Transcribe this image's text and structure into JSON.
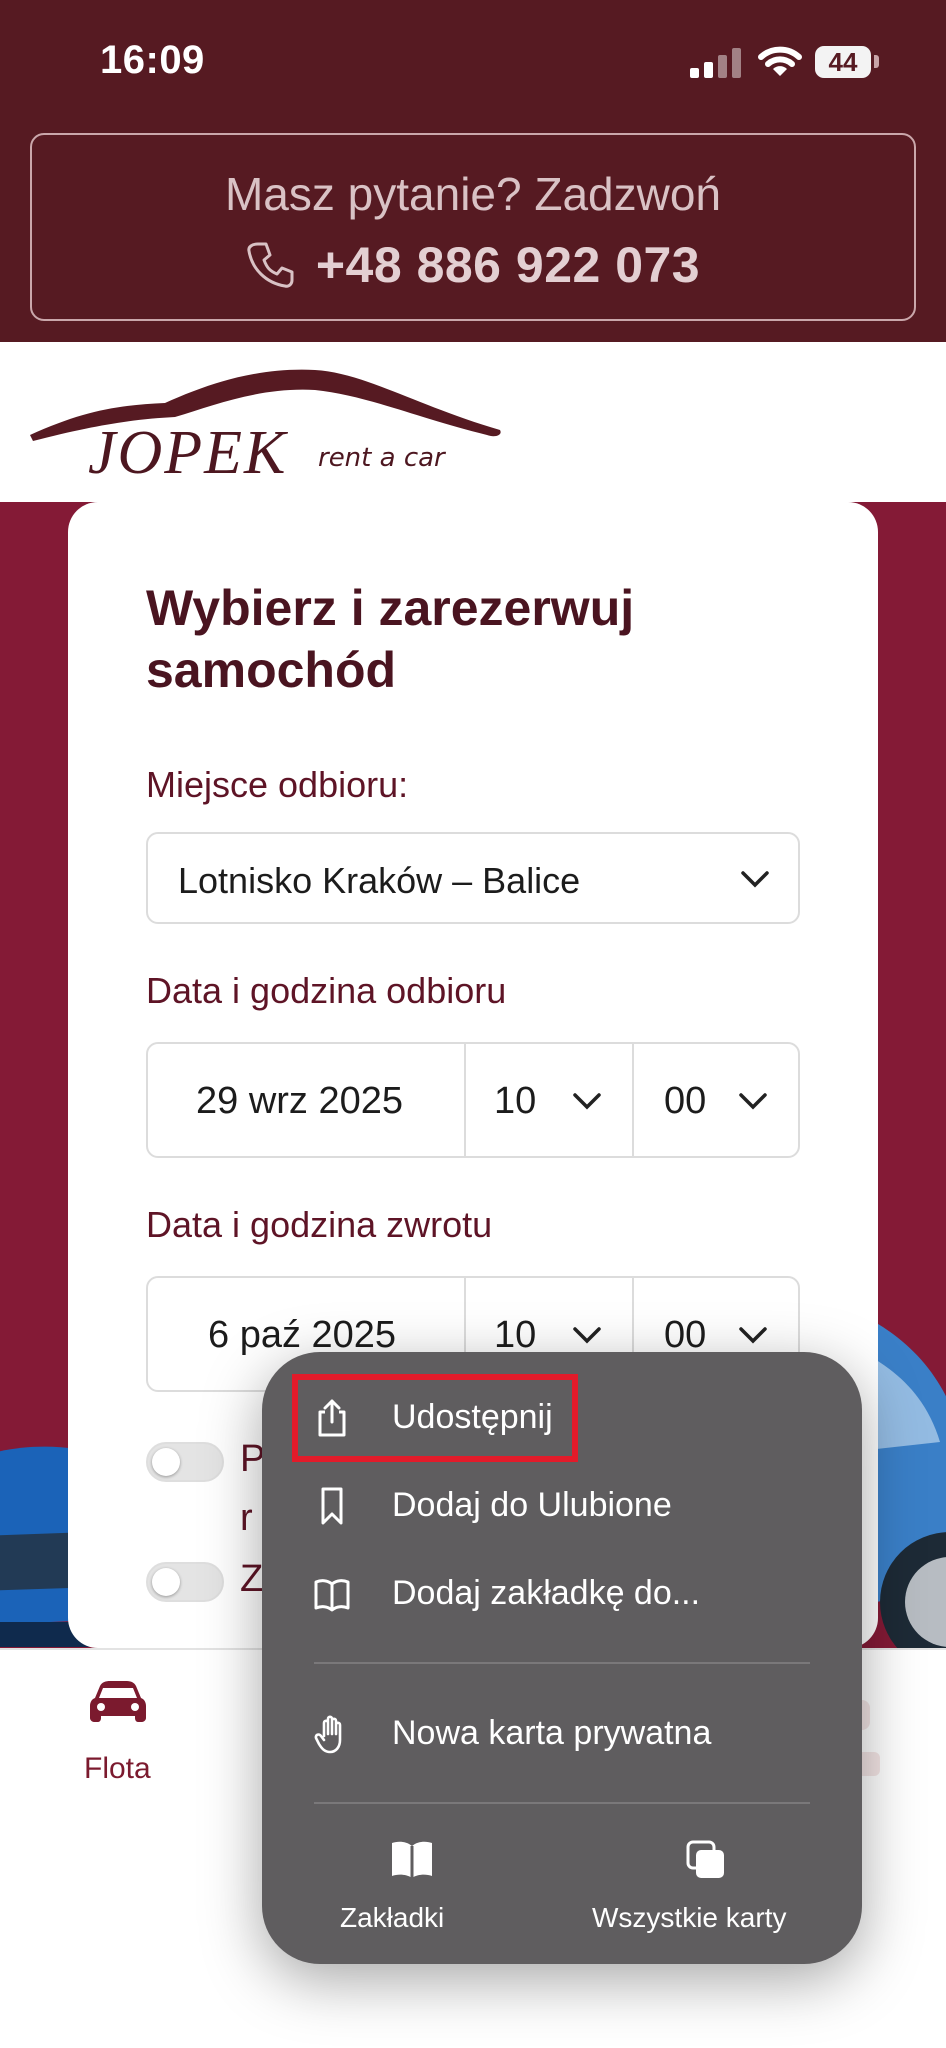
{
  "status_bar": {
    "time": "16:09",
    "battery": "44"
  },
  "banner": {
    "question": "Masz pytanie? Zadzwoń",
    "phone": "+48 886 922 073"
  },
  "logo": {
    "brand": "JOPEK",
    "tagline": "rent a car"
  },
  "form": {
    "title": "Wybierz i zarezerwuj samochód",
    "pickup_place_label": "Miejsce odbioru:",
    "pickup_place_value": "Lotnisko Kraków – Balice",
    "pickup_dt_label": "Data i godzina odbioru",
    "pickup_date": "29 wrz 2025",
    "pickup_hour": "10",
    "pickup_min": "00",
    "return_dt_label": "Data i godzina zwrotu",
    "return_date": "6 paź 2025",
    "return_hour": "10",
    "return_min": "00",
    "toggle1_text_line1": "P",
    "toggle1_text_line2": "r",
    "toggle2_text": "Z"
  },
  "bottom_nav": {
    "fleet_label": "Flota"
  },
  "context_menu": {
    "items": [
      {
        "label": "Udostępnij",
        "icon": "share-icon"
      },
      {
        "label": "Dodaj do Ulubione",
        "icon": "bookmark-icon"
      },
      {
        "label": "Dodaj zakładkę do...",
        "icon": "book-icon"
      },
      {
        "label": "Nowa karta prywatna",
        "icon": "hand-icon"
      }
    ],
    "bottom": [
      {
        "label": "Zakładki",
        "icon": "bookmarks-icon"
      },
      {
        "label": "Wszystkie karty",
        "icon": "tabs-icon"
      }
    ],
    "highlight_color": "#e21b2a"
  },
  "colors": {
    "brand_dark": "#561a22",
    "hero": "#841a36",
    "accent_text": "#5e1426"
  }
}
